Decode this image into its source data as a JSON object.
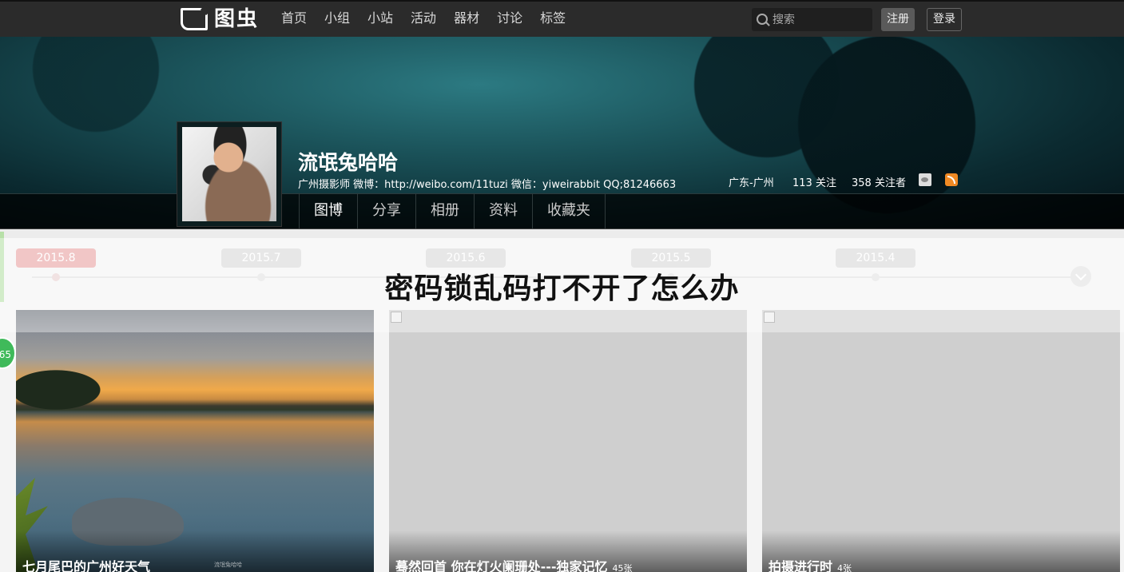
{
  "topbar": {
    "logo_text": "图虫",
    "nav": [
      "首页",
      "小组",
      "小站",
      "活动",
      "器材",
      "讨论",
      "标签"
    ],
    "search_placeholder": "搜索",
    "register_label": "注册",
    "login_label": "登录"
  },
  "profile": {
    "name": "流氓兔哈哈",
    "bio": "广州摄影师 微博：http://weibo.com/11tuzi 微信：yiweirabbit QQ;81246663",
    "location": "广东-广州",
    "following": "113 关注",
    "followers": "358 关注者",
    "tabs": [
      "图博",
      "分享",
      "相册",
      "资料",
      "收藏夹"
    ],
    "active_tab": "图博"
  },
  "timeline": {
    "dates": [
      "2015.8",
      "2015.7",
      "2015.6",
      "2015.5",
      "2015.4"
    ],
    "active": "2015.8"
  },
  "float_badge": "65",
  "headline": "密码锁乱码打不开了怎么办",
  "cards": [
    {
      "title": "七月尾巴的广州好天气",
      "count": "",
      "watermark": "流氓兔哈哈"
    },
    {
      "title": "蓦然回首 你在灯火阑珊处---独家记忆",
      "count": "45张"
    },
    {
      "title": "拍摄进行时",
      "count": "4张"
    }
  ],
  "colors": {
    "topbar_bg": "#2b2b2b",
    "active_date": "#e8a3a3",
    "badge_green": "#3fba5a"
  }
}
